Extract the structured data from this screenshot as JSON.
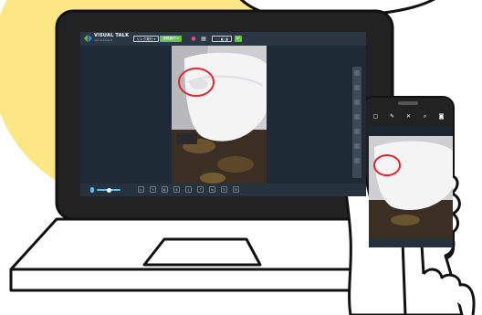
{
  "colors": {
    "bubble": "#fde785",
    "outline": "#111111",
    "screen_bg": "#1e2a36",
    "accent_green": "#6cc04a",
    "highlight_red": "#e0262e",
    "mic_blue": "#59c3e8"
  },
  "app": {
    "logo_title": "VISUAL TALK",
    "logo_subtitle": "remote support",
    "header": {
      "link_button": "リンク発行 ▾",
      "control_button": "遠隔操作 ▾",
      "record_icon": "record-icon",
      "grid_icon": "grid-icon",
      "call_button": "📞 ◧ ◨"
    },
    "toolbar_icons": [
      "folder-icon",
      "pen-icon",
      "mask-icon",
      "zoom-icon",
      "download-icon",
      "upload-icon",
      "compare-icon",
      "refresh-icon",
      "settings-icon"
    ]
  },
  "phone": {
    "top_icons": [
      "chat-icon",
      "pen-icon",
      "close-icon",
      "zoom-icon",
      "camera-icon"
    ]
  }
}
